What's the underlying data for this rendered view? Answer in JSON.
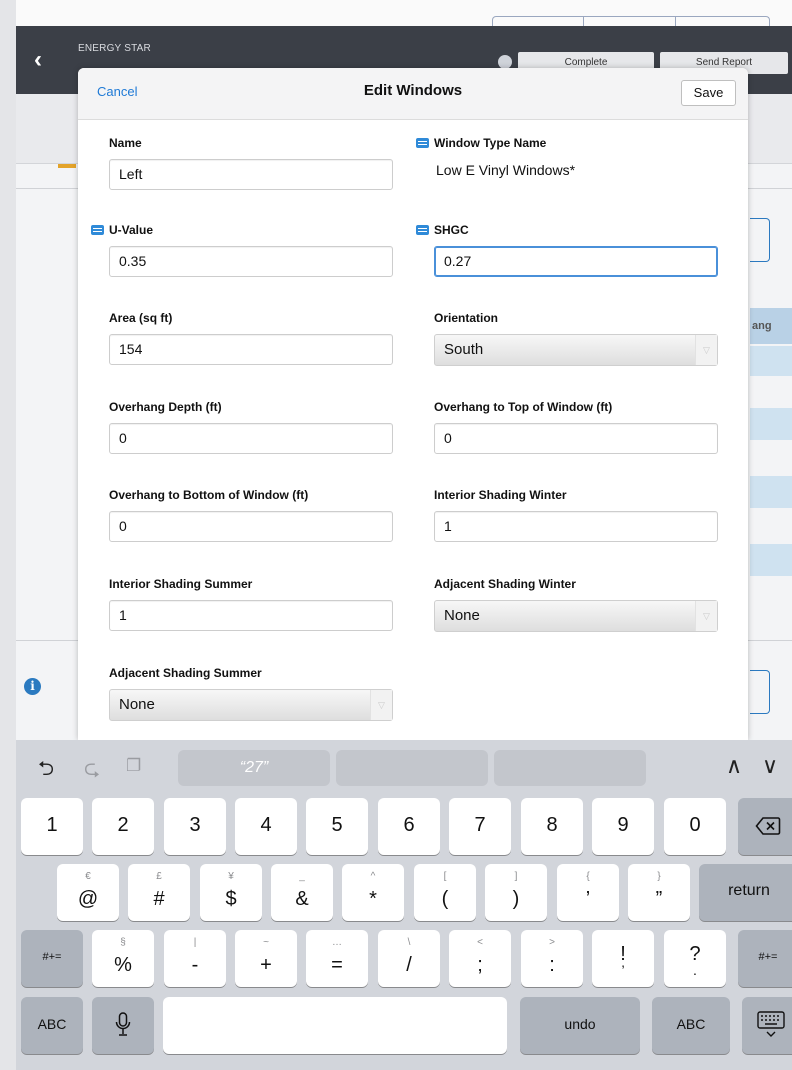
{
  "background": {
    "app_label": "ENERGY STAR",
    "nav_buttons": [
      "Complete",
      "Send Report"
    ]
  },
  "modal": {
    "cancel_label": "Cancel",
    "title": "Edit Windows",
    "save_label": "Save"
  },
  "fields": {
    "name": {
      "label": "Name",
      "value": "Left"
    },
    "window_type": {
      "label": "Window Type Name",
      "value": "Low E Vinyl Windows*"
    },
    "u_value": {
      "label": "U-Value",
      "value": "0.35"
    },
    "shgc": {
      "label": "SHGC",
      "value": "0.27"
    },
    "area": {
      "label": "Area (sq ft)",
      "value": "154"
    },
    "orientation": {
      "label": "Orientation",
      "value": "South"
    },
    "overhang_depth": {
      "label": "Overhang Depth (ft)",
      "value": "0"
    },
    "overhang_top": {
      "label": "Overhang to Top of Window (ft)",
      "value": "0"
    },
    "overhang_bottom": {
      "label": "Overhang to Bottom of Window (ft)",
      "value": "0"
    },
    "int_shading_winter": {
      "label": "Interior Shading Winter",
      "value": "1"
    },
    "int_shading_summer": {
      "label": "Interior Shading Summer",
      "value": "1"
    },
    "adj_shading_winter": {
      "label": "Adjacent Shading Winter",
      "value": "None"
    },
    "adj_shading_summer": {
      "label": "Adjacent Shading Summer",
      "value": "None"
    }
  },
  "keyboard": {
    "suggestion": "“27”",
    "row1": [
      "1",
      "2",
      "3",
      "4",
      "5",
      "6",
      "7",
      "8",
      "9",
      "0"
    ],
    "row2": [
      {
        "main": "@",
        "alt": "€"
      },
      {
        "main": "#",
        "alt": "£"
      },
      {
        "main": "$",
        "alt": "¥"
      },
      {
        "main": "&",
        "alt": "_"
      },
      {
        "main": "*",
        "alt": "^"
      },
      {
        "main": "(",
        "alt": "["
      },
      {
        "main": ")",
        "alt": "]"
      },
      {
        "main": "’",
        "alt": "{"
      },
      {
        "main": "”",
        "alt": "}"
      }
    ],
    "return_label": "return",
    "row3": [
      {
        "main": "%",
        "alt": "§"
      },
      {
        "main": "-",
        "alt": "|"
      },
      {
        "main": "+",
        "alt": "~"
      },
      {
        "main": "=",
        "alt": "…"
      },
      {
        "main": "/",
        "alt": "\\"
      },
      {
        "main": ";",
        "alt": "<"
      },
      {
        "main": ":",
        "alt": ">"
      },
      {
        "main": "!",
        "alt": "’"
      },
      {
        "main": "?",
        "alt": "."
      }
    ],
    "symbol_toggle": "#+=",
    "abc_label": "ABC",
    "undo_label": "undo"
  }
}
